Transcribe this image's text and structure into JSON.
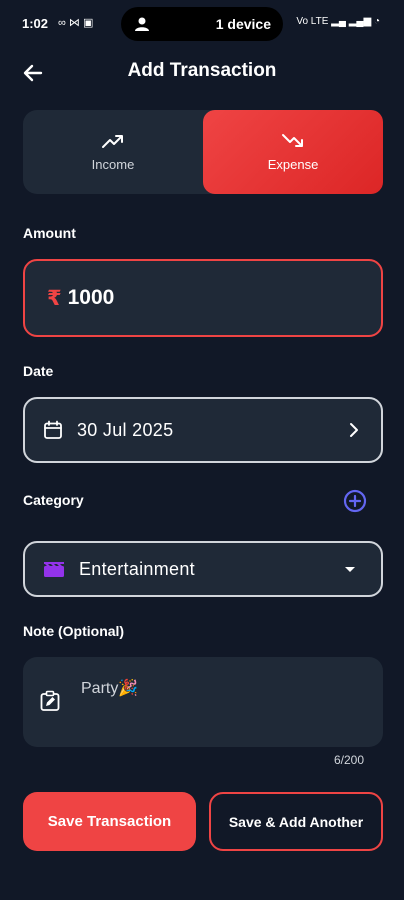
{
  "status_bar": {
    "time": "1:02",
    "left_icons": "∞ ⋈ ▣",
    "island_text": "1 device",
    "right_icons": "Vo LTE ▂▄ ▂▄▆ ◔"
  },
  "header": {
    "title": "Add Transaction"
  },
  "type_toggle": {
    "income_label": "Income",
    "expense_label": "Expense",
    "selected": "Expense",
    "selected_color": "#ef4444"
  },
  "amount": {
    "label": "Amount",
    "currency_symbol": "₹",
    "value": "1000"
  },
  "date": {
    "label": "Date",
    "value": "30 Jul 2025"
  },
  "category": {
    "label": "Category",
    "value": "Entertainment",
    "icon": "clapperboard-icon",
    "icon_color": "#9333ea"
  },
  "note": {
    "label": "Note (Optional)",
    "value": "Party🎉",
    "char_count": "6/200"
  },
  "buttons": {
    "save_label": "Save Transaction",
    "save_another_label": "Save & Add Another"
  },
  "colors": {
    "background": "#111827",
    "surface": "#1f2937",
    "accent": "#ef4444",
    "add_icon": "#6366f1"
  }
}
